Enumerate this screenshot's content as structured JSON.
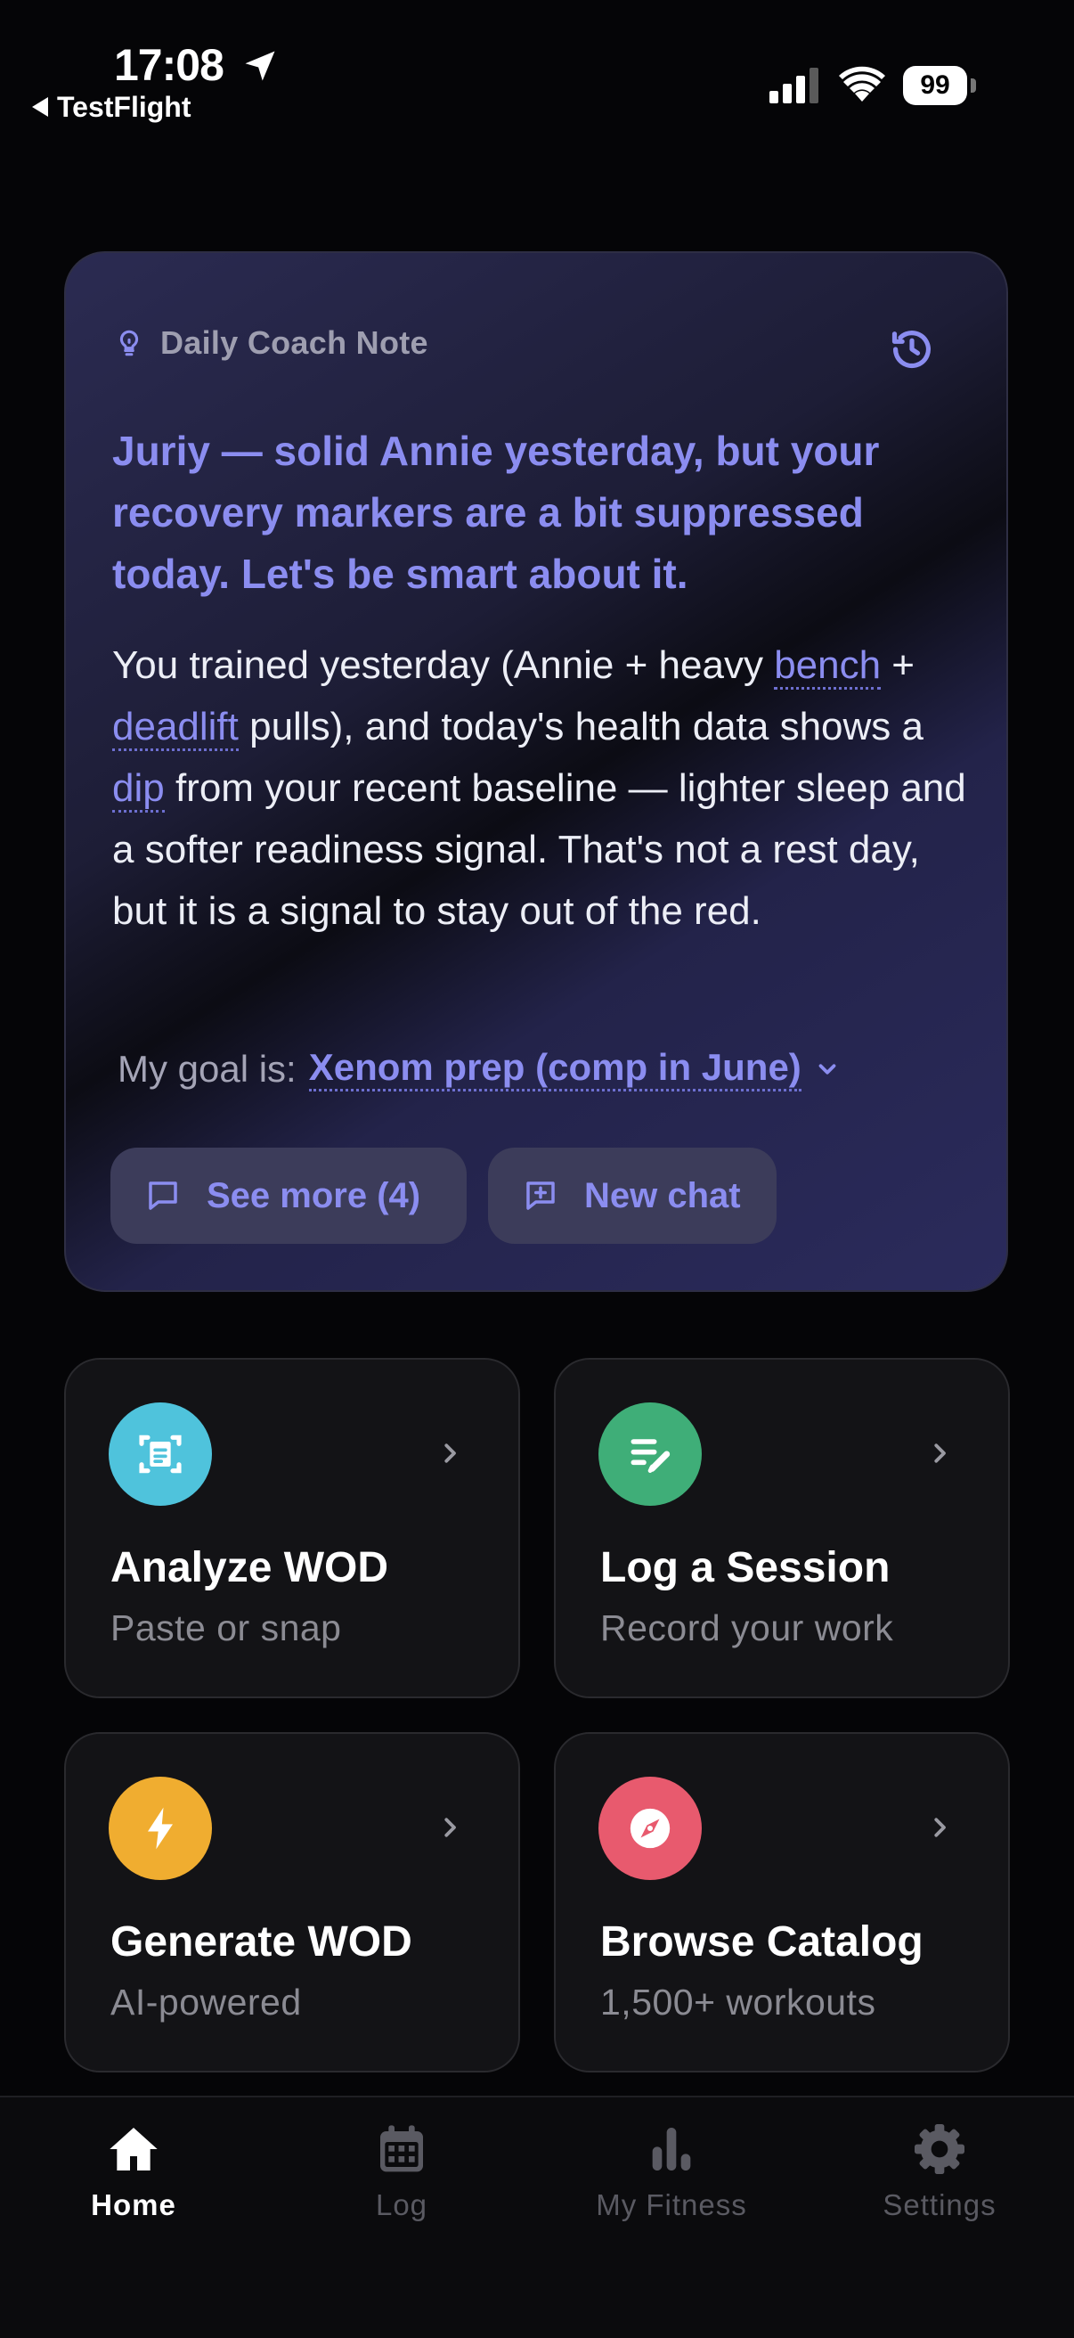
{
  "status_bar": {
    "time": "17:08",
    "back_app": "TestFlight",
    "battery": "99",
    "icons": [
      "location-arrow-icon",
      "cellular-signal-icon",
      "wifi-icon",
      "battery-icon"
    ]
  },
  "coach_note": {
    "label": "Daily Coach Note",
    "icons": [
      "lightbulb-icon",
      "history-icon"
    ],
    "headline": "Juriy — solid Annie yesterday, but your recovery markers are a bit suppressed today. Let's be smart about it.",
    "body": {
      "p1": "You trained yesterday (Annie + heavy ",
      "term1": "bench",
      "p2": " + ",
      "term2": "deadlift",
      "p3": " pulls), and today's health data shows a ",
      "term3": "dip",
      "p4": " from your recent baseline — lighter sleep and a softer readiness signal. That's not a rest day, but it is a signal to stay out of the red."
    },
    "goal_prefix": "My goal is:",
    "goal_value": "Xenom prep (comp in June)",
    "see_more_label": "See more (4)",
    "new_chat_label": "New chat",
    "accent_color": "#8b8df0"
  },
  "actions": [
    {
      "title": "Analyze WOD",
      "subtitle": "Paste or snap",
      "icon": "scan-document-icon",
      "color": "#4fc3dc"
    },
    {
      "title": "Log a Session",
      "subtitle": "Record your work",
      "icon": "edit-list-icon",
      "color": "#3fae78"
    },
    {
      "title": "Generate WOD",
      "subtitle": "AI-powered",
      "icon": "bolt-icon",
      "color": "#f0ad30"
    },
    {
      "title": "Browse Catalog",
      "subtitle": "1,500+ workouts",
      "icon": "compass-icon",
      "color": "#e85a6e"
    }
  ],
  "tabs": [
    {
      "label": "Home",
      "icon": "home-icon",
      "active": true
    },
    {
      "label": "Log",
      "icon": "calendar-icon",
      "active": false
    },
    {
      "label": "My Fitness",
      "icon": "bar-chart-icon",
      "active": false
    },
    {
      "label": "Settings",
      "icon": "gear-icon",
      "active": false
    }
  ]
}
